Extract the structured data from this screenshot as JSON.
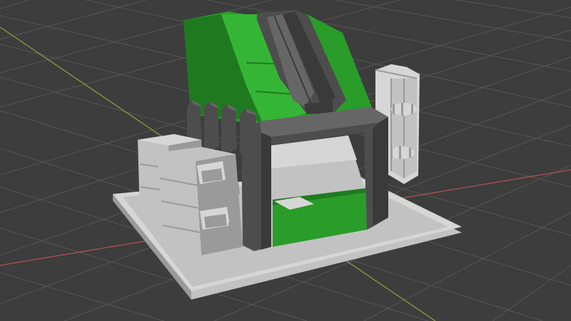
{
  "viewport": {
    "mode": "3D Viewport",
    "background": "#3d3d3d",
    "grid_color": "#565656",
    "axis_x_color": "#b0505c",
    "axis_y_color": "#87a13c"
  },
  "scene": {
    "object": "model",
    "colors": {
      "green": "#2a9c2a",
      "green_light": "#35b535",
      "green_dark": "#1f7a1f",
      "concrete": "#c2c2c2",
      "concrete_light": "#d6d6d6",
      "concrete_dark": "#9a9a9a",
      "metal": "#4d4d4d",
      "metal_dark": "#3a3a3a",
      "metal_light": "#666666"
    }
  }
}
